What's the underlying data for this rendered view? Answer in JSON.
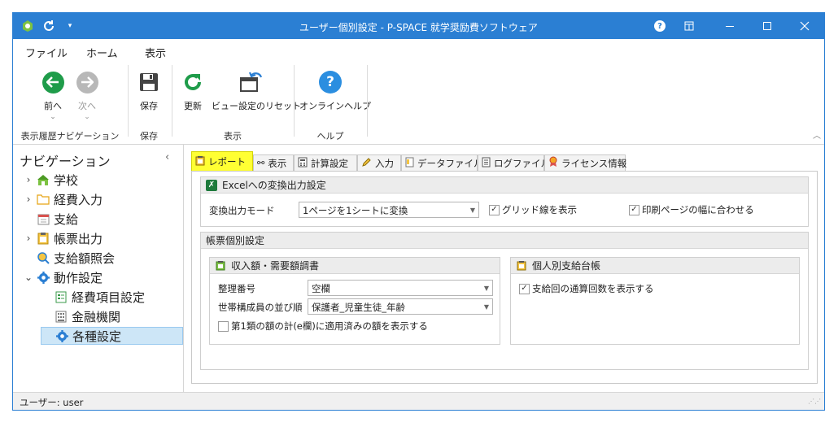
{
  "window": {
    "title": "ユーザー個別設定 - P-SPACE 就学奨励費ソフトウェア",
    "accent_color": "#2b7fd3",
    "qat_icons": [
      "app-icon",
      "refresh-icon",
      "dropdown-icon"
    ],
    "title_buttons": [
      "help-icon",
      "options-icon",
      "minimize-icon",
      "maximize-icon",
      "close-icon"
    ]
  },
  "menu": {
    "tabs": [
      {
        "label": "ファイル"
      },
      {
        "label": "ホーム",
        "active": true
      },
      {
        "label": "表示"
      }
    ]
  },
  "ribbon": {
    "buttons": {
      "back": "前へ",
      "forward": "次へ",
      "save": "保存",
      "refresh": "更新",
      "reset_view": "ビュー設定のリセット",
      "online_help": "オンラインヘルプ"
    },
    "groups": {
      "nav_history": "表示履歴ナビゲーション",
      "save": "保存",
      "view": "表示",
      "help": "ヘルプ"
    }
  },
  "sidebar": {
    "title": "ナビゲーション",
    "items": [
      {
        "label": "学校",
        "icon": "school-icon",
        "expandable": true
      },
      {
        "label": "経費入力",
        "icon": "folder-icon",
        "expandable": true
      },
      {
        "label": "支給",
        "icon": "calendar-icon",
        "expandable": false
      },
      {
        "label": "帳票出力",
        "icon": "clipboard-icon",
        "expandable": true
      },
      {
        "label": "支給額照会",
        "icon": "search-money-icon",
        "expandable": false
      },
      {
        "label": "動作設定",
        "icon": "gear-icon",
        "expandable": true,
        "expanded": true
      },
      {
        "label": "経費項目設定",
        "icon": "form-icon",
        "child": true
      },
      {
        "label": "金融機関",
        "icon": "bank-icon",
        "child": true
      },
      {
        "label": "各種設定",
        "icon": "gear-icon",
        "child": true,
        "selected": true
      }
    ]
  },
  "tabs": [
    {
      "label": "レポート",
      "icon": "report-icon",
      "active": true
    },
    {
      "label": "表示",
      "icon": "glasses-icon"
    },
    {
      "label": "計算設定",
      "icon": "calculator-icon"
    },
    {
      "label": "入力",
      "icon": "pencil-icon"
    },
    {
      "label": "データファイル",
      "icon": "data-file-icon"
    },
    {
      "label": "ログファイル",
      "icon": "log-file-icon"
    },
    {
      "label": "ライセンス情報",
      "icon": "license-icon"
    }
  ],
  "excel": {
    "title": "Excelへの変換出力設定",
    "mode_label": "変換出力モード",
    "mode_value": "1ページを1シートに変換",
    "gridlines_label": "グリッド線を表示",
    "gridlines_checked": true,
    "fitpage_label": "印刷ページの幅に合わせる",
    "fitpage_checked": true
  },
  "report": {
    "title": "帳票個別設定",
    "income": {
      "title": "収入額・需要額調書",
      "number_label": "整理番号",
      "number_value": "空欄",
      "order_label": "世帯構成員の並び順",
      "order_value": "保護者_児童生徒_年齢",
      "class1_label": "第1類の額の計(e欄)に適用済みの額を表示する",
      "class1_checked": false
    },
    "ledger": {
      "title": "個人別支給台帳",
      "count_label": "支給回の通算回数を表示する",
      "count_checked": true
    }
  },
  "status": {
    "user": "ユーザー: user"
  }
}
